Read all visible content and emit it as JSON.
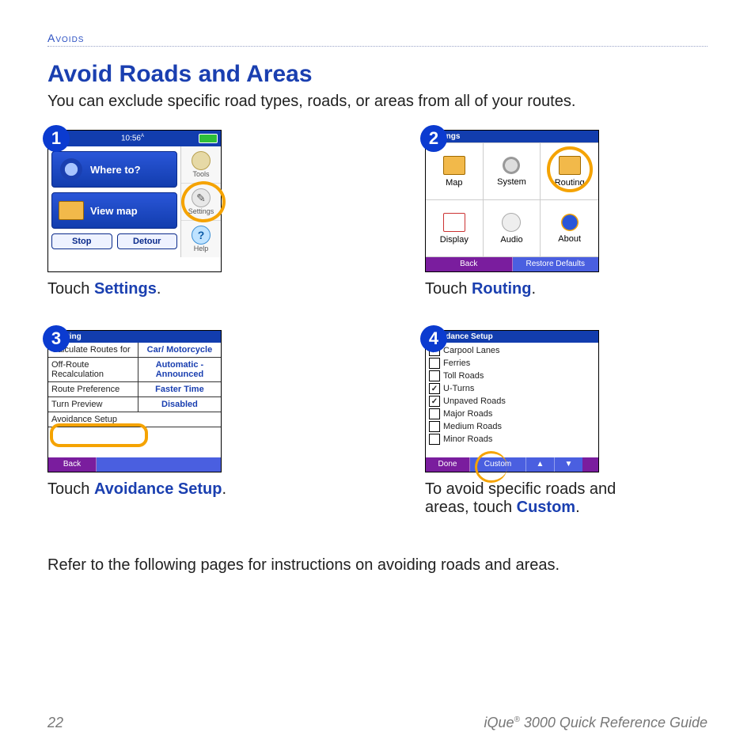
{
  "section_tag": "Avoids",
  "heading": "Avoid Roads and Areas",
  "intro": "You can exclude specific road types, roads, or areas from all of your routes.",
  "steps": {
    "s1": {
      "num": "1",
      "clock": "10:56",
      "ampm": "A M",
      "where": "Where to?",
      "viewmap": "View map",
      "stop": "Stop",
      "detour": "Detour",
      "tools": "Tools",
      "settings": "Settings",
      "help": "Help",
      "caption_prefix": "Touch ",
      "caption_kw": "Settings",
      "caption_suffix": "."
    },
    "s2": {
      "num": "2",
      "title": "Settings",
      "cells": [
        "Map",
        "System",
        "Routing",
        "Display",
        "Audio",
        "About"
      ],
      "back": "Back",
      "restore": "Restore Defaults",
      "caption_prefix": "Touch ",
      "caption_kw": "Routing",
      "caption_suffix": "."
    },
    "s3": {
      "num": "3",
      "title": "Routing",
      "rows": [
        {
          "label": "Calculate Routes for",
          "value": "Car/ Motorcycle"
        },
        {
          "label": "Off-Route Recalculation",
          "value": "Automatic - Announced"
        },
        {
          "label": "Route Preference",
          "value": "Faster Time"
        },
        {
          "label": "Turn Preview",
          "value": "Disabled"
        },
        {
          "label": "Avoidance Setup",
          "value": ""
        }
      ],
      "back": "Back",
      "caption_prefix": "Touch ",
      "caption_kw": "Avoidance Setup",
      "caption_suffix": "."
    },
    "s4": {
      "num": "4",
      "title": "Avoidance Setup",
      "items": [
        {
          "label": "Carpool Lanes",
          "checked": true
        },
        {
          "label": "Ferries",
          "checked": false
        },
        {
          "label": "Toll Roads",
          "checked": false
        },
        {
          "label": "U-Turns",
          "checked": true
        },
        {
          "label": "Unpaved Roads",
          "checked": true
        },
        {
          "label": "Major Roads",
          "checked": false
        },
        {
          "label": "Medium Roads",
          "checked": false
        },
        {
          "label": "Minor Roads",
          "checked": false
        }
      ],
      "done": "Done",
      "custom": "Custom",
      "caption_prefix": "To avoid specific roads and areas, touch ",
      "caption_kw": "Custom",
      "caption_suffix": "."
    }
  },
  "bottom_note": "Refer to the following pages for instructions on avoiding roads and areas.",
  "footer": {
    "page": "22",
    "product": "iQue",
    "reg": "®",
    "rest": " 3000 Quick Reference Guide"
  }
}
